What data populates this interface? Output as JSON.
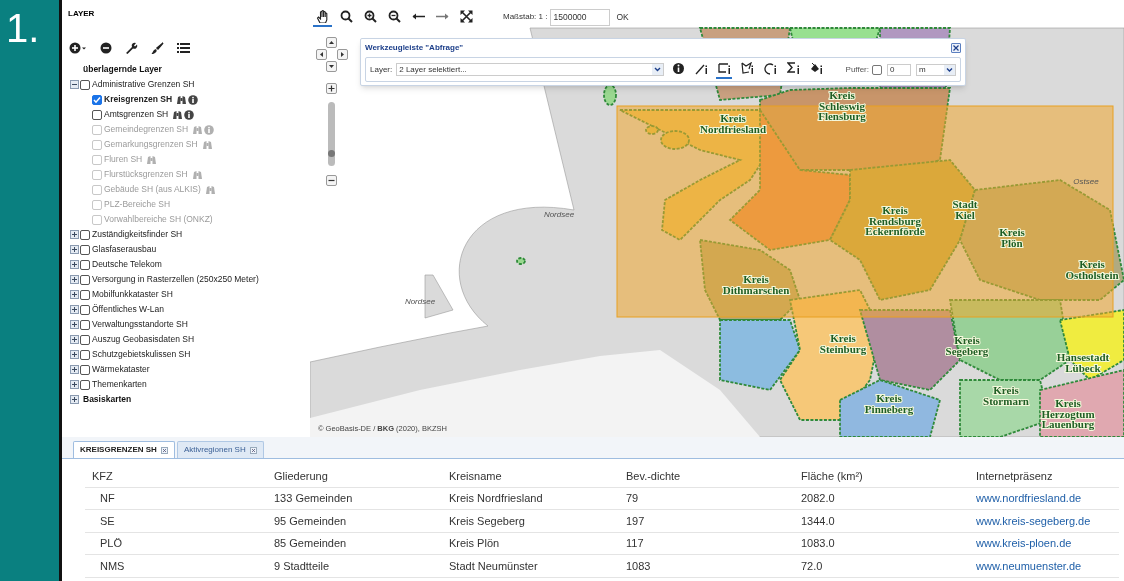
{
  "badge": "1.",
  "layer_panel": {
    "title": "LAYER",
    "toolbar": [
      {
        "kind": "add"
      },
      {
        "kind": "remove"
      },
      {
        "kind": "wrench"
      },
      {
        "kind": "brush"
      },
      {
        "kind": "list"
      }
    ],
    "tree": [
      {
        "kind": "heading",
        "label": "überlagernde Layer"
      },
      {
        "kind": "group",
        "label": "Administrative Grenzen SH",
        "expanded": true,
        "checked": false,
        "children": [
          {
            "kind": "layer",
            "label": "Kreisgrenzen SH",
            "checked": true,
            "disabled": false,
            "search": true,
            "info": true
          },
          {
            "kind": "layer",
            "label": "Amtsgrenzen SH",
            "checked": false,
            "disabled": false,
            "search": true,
            "info": true
          },
          {
            "kind": "layer",
            "label": "Gemeindegrenzen SH",
            "checked": false,
            "disabled": true,
            "search": true,
            "info": true
          },
          {
            "kind": "layer",
            "label": "Gemarkungsgrenzen SH",
            "checked": false,
            "disabled": true,
            "search": true,
            "info": false
          },
          {
            "kind": "layer",
            "label": "Fluren SH",
            "checked": false,
            "disabled": true,
            "search": true,
            "info": false
          },
          {
            "kind": "layer",
            "label": "Flurstücksgrenzen SH",
            "checked": false,
            "disabled": true,
            "search": true,
            "info": false
          },
          {
            "kind": "layer",
            "label": "Gebäude SH (aus ALKIS)",
            "checked": false,
            "disabled": true,
            "search": true,
            "info": false
          },
          {
            "kind": "layer",
            "label": "PLZ-Bereiche SH",
            "checked": false,
            "disabled": true,
            "search": false,
            "info": false
          },
          {
            "kind": "layer",
            "label": "Vorwahlbereiche SH (ONKZ)",
            "checked": false,
            "disabled": true,
            "search": false,
            "info": false
          }
        ]
      },
      {
        "kind": "group",
        "label": "Zuständigkeitsfinder SH",
        "expanded": false,
        "checked": false
      },
      {
        "kind": "group",
        "label": "Glasfaserausbau",
        "expanded": false,
        "checked": false
      },
      {
        "kind": "group",
        "label": "Deutsche Telekom",
        "expanded": false,
        "checked": false
      },
      {
        "kind": "group",
        "label": "Versorgung in Rasterzellen (250x250 Meter)",
        "expanded": false,
        "checked": false
      },
      {
        "kind": "group",
        "label": "Mobilfunkkataster SH",
        "expanded": false,
        "checked": false
      },
      {
        "kind": "group",
        "label": "Öffentliches W-Lan",
        "expanded": false,
        "checked": false
      },
      {
        "kind": "group",
        "label": "Verwaltungsstandorte SH",
        "expanded": false,
        "checked": false
      },
      {
        "kind": "group",
        "label": "Auszug Geobasisdaten SH",
        "expanded": false,
        "checked": false
      },
      {
        "kind": "group",
        "label": "Schutzgebietskulissen SH",
        "expanded": false,
        "checked": false
      },
      {
        "kind": "group",
        "label": "Wärmekataster",
        "expanded": false,
        "checked": false
      },
      {
        "kind": "group",
        "label": "Themenkarten",
        "expanded": false,
        "checked": false
      },
      {
        "kind": "root",
        "label": "Basiskarten",
        "expanded": false
      }
    ]
  },
  "map_toolbar": {
    "tools": [
      {
        "kind": "pan",
        "selected": true
      },
      {
        "kind": "search",
        "selected": false
      },
      {
        "kind": "zoom_in",
        "selected": false
      },
      {
        "kind": "zoom_out",
        "selected": false
      },
      {
        "kind": "back",
        "selected": false
      },
      {
        "kind": "forward",
        "selected": false
      },
      {
        "kind": "full_extent",
        "selected": false
      }
    ],
    "scale_label": "Maßstab: 1 :",
    "scale_value": "1500000",
    "ok_button": "OK"
  },
  "zoom_slider": {
    "level": 0.15
  },
  "query_toolbar": {
    "title": "Werkzeugleiste \"Abfrage\"",
    "layer_label": "Layer:",
    "layer_value": "2 Layer selektiert...",
    "tools": [
      {
        "kind": "info",
        "selected": false
      },
      {
        "kind": "line",
        "selected": false
      },
      {
        "kind": "rectangle",
        "selected": true
      },
      {
        "kind": "polygon",
        "selected": false
      },
      {
        "kind": "circle",
        "selected": false
      },
      {
        "kind": "sum",
        "selected": false
      },
      {
        "kind": "fill",
        "selected": false
      }
    ],
    "buffer_label": "Puffer:",
    "buffer_checked": false,
    "buffer_value": "0",
    "unit": "m"
  },
  "map": {
    "labels": [
      {
        "kind": "region",
        "lines": [
          "Kreis",
          "Schleswig",
          "Flensburg"
        ]
      },
      {
        "kind": "region",
        "lines": [
          "Kreis",
          "Nordfriesland"
        ]
      },
      {
        "kind": "water",
        "lines": [
          "Ostsee"
        ]
      },
      {
        "kind": "water",
        "lines": [
          "Nordsee"
        ]
      },
      {
        "kind": "region",
        "lines": [
          "Kreis",
          "Rendsburg",
          "Eckernförde"
        ]
      },
      {
        "kind": "region",
        "lines": [
          "Stadt",
          "Kiel"
        ]
      },
      {
        "kind": "region",
        "lines": [
          "Kreis",
          "Plön"
        ]
      },
      {
        "kind": "region",
        "lines": [
          "Kreis",
          "Ostholstein"
        ]
      },
      {
        "kind": "region",
        "lines": [
          "Kreis",
          "Dithmarschen"
        ]
      },
      {
        "kind": "water",
        "lines": [
          "Nordsee"
        ]
      },
      {
        "kind": "region",
        "lines": [
          "Kreis",
          "Steinburg"
        ]
      },
      {
        "kind": "region",
        "lines": [
          "Kreis",
          "Segeberg"
        ]
      },
      {
        "kind": "region",
        "lines": [
          "Hansestadt",
          "Lübeck"
        ]
      },
      {
        "kind": "region",
        "lines": [
          "Kreis",
          "Stormarn"
        ]
      },
      {
        "kind": "region",
        "lines": [
          "Kreis",
          "Pinneberg"
        ]
      },
      {
        "kind": "region",
        "lines": [
          "Kreis",
          "Herzogtum",
          "Lauenburg"
        ]
      }
    ],
    "attribution": "© GeoBasis-DE / **BKG** (2020), BKZSH"
  },
  "bottom_panel": {
    "tabs": [
      {
        "label": "KREISGRENZEN SH",
        "selected": true
      },
      {
        "label": "Aktivregionen SH",
        "selected": false
      }
    ],
    "table": {
      "columns": [
        "KFZ",
        "Gliederung",
        "Kreisname",
        "Bev.-dichte",
        "Fläche (km²)",
        "Internetpräsenz"
      ],
      "rows": [
        [
          "NF",
          "133 Gemeinden",
          "Kreis Nordfriesland",
          "79",
          "2082.0",
          "www.nordfriesland.de"
        ],
        [
          "SE",
          "95 Gemeinden",
          "Kreis Segeberg",
          "197",
          "1344.0",
          "www.kreis-segeberg.de"
        ],
        [
          "PLÖ",
          "85 Gemeinden",
          "Kreis Plön",
          "117",
          "1083.0",
          "www.kreis-ploen.de"
        ],
        [
          "NMS",
          "9 Stadtteile",
          "Stadt Neumünster",
          "1083",
          "72.0",
          "www.neumuenster.de"
        ]
      ]
    }
  }
}
